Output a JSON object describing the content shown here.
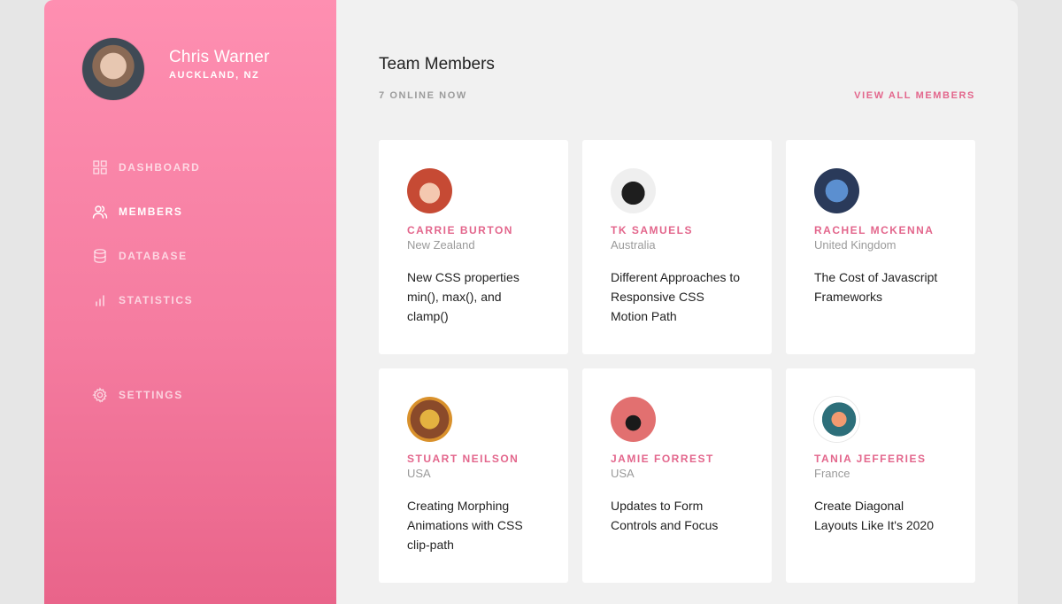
{
  "profile": {
    "name": "Chris Warner",
    "location": "AUCKLAND, NZ",
    "avatar_icon": "user-photo"
  },
  "nav": [
    {
      "label": "DASHBOARD",
      "icon": "grid-icon",
      "active": false
    },
    {
      "label": "MEMBERS",
      "icon": "users-icon",
      "active": true
    },
    {
      "label": "DATABASE",
      "icon": "database-icon",
      "active": false
    },
    {
      "label": "STATISTICS",
      "icon": "bar-chart-icon",
      "active": false
    },
    {
      "label": "SETTINGS",
      "icon": "gear-icon",
      "active": false
    }
  ],
  "main": {
    "title": "Team Members",
    "online": "7 ONLINE NOW",
    "view_all": "VIEW ALL MEMBERS"
  },
  "members": [
    {
      "name": "CARRIE BURTON",
      "country": "New Zealand",
      "post": "New CSS properties min(), max(), and clamp()"
    },
    {
      "name": "TK SAMUELS",
      "country": "Australia",
      "post": "Different Approaches to Responsive CSS Motion Path"
    },
    {
      "name": "RACHEL MCKENNA",
      "country": "United Kingdom",
      "post": "The Cost of Javascript Frameworks"
    },
    {
      "name": "STUART NEILSON",
      "country": "USA",
      "post": "Creating Morphing Animations with CSS clip-path"
    },
    {
      "name": "JAMIE FORREST",
      "country": "USA",
      "post": "Updates to Form Controls and Focus"
    },
    {
      "name": "TANIA JEFFERIES",
      "country": "France",
      "post": "Create Diagonal Layouts Like It's 2020"
    }
  ],
  "colors": {
    "accent": "#e3668c",
    "sidebar_top": "#fe8fb1",
    "sidebar_bottom": "#e9648a",
    "background": "#f1f1f1"
  }
}
